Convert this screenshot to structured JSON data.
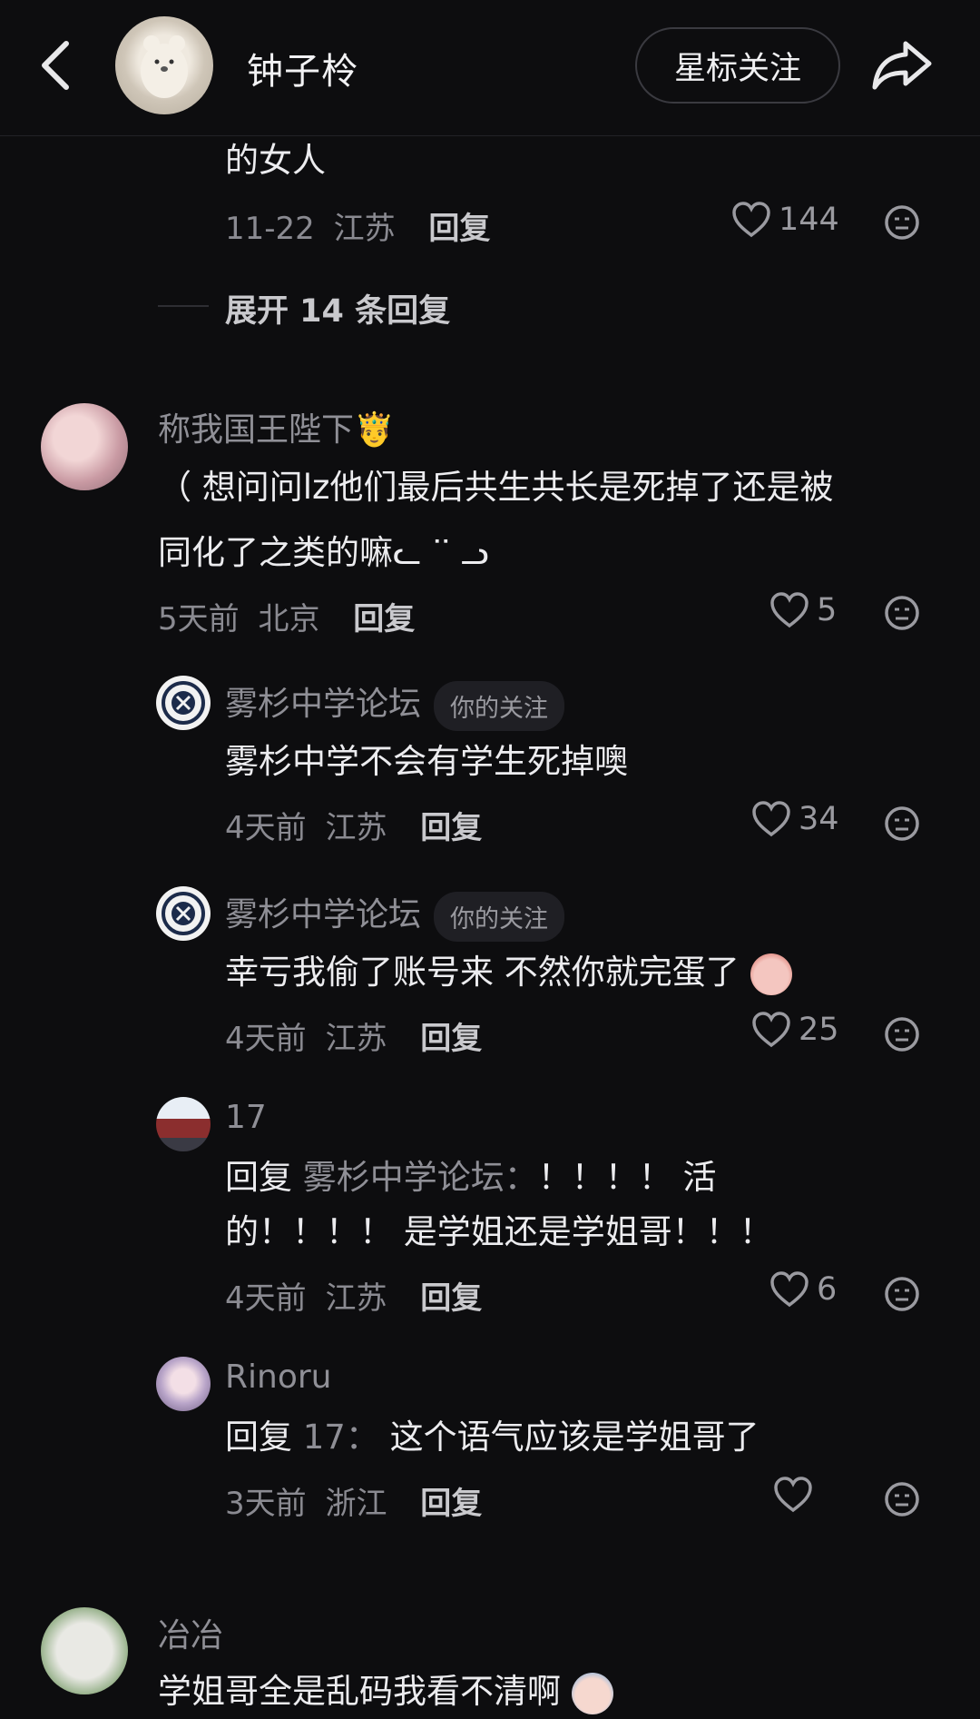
{
  "header": {
    "name": "钟子柃",
    "star_follow": "星标关注"
  },
  "top_comment": {
    "text_tail": "的女人",
    "time": "11-22",
    "location": "江苏",
    "reply": "回复",
    "likes": "144",
    "expand": "展开 14 条回复"
  },
  "comment_main": {
    "author": "称我国王陛下🤴",
    "text_line1": "（ 想问问lz他们最后共生共长是死掉了还是被",
    "text_line2": "同化了之类的嘛ᓚ ᐝᐝ ᓗ",
    "time": "5天前",
    "location": "北京",
    "reply": "回复",
    "likes": "5"
  },
  "replies": [
    {
      "author": "雾杉中学论坛",
      "badge": "你的关注",
      "text": "雾杉中学不会有学生死掉噢",
      "time": "4天前",
      "location": "江苏",
      "reply": "回复",
      "likes": "34"
    },
    {
      "author": "雾杉中学论坛",
      "badge": "你的关注",
      "text": "幸亏我偷了账号来 不然你就完蛋了",
      "time": "4天前",
      "location": "江苏",
      "reply": "回复",
      "likes": "25"
    },
    {
      "author": "17",
      "reply_prefix": "回复",
      "reply_to": "雾杉中学论坛：",
      "text_line1": "！！！！ 活",
      "text_line2": "的！！！！ 是学姐还是学姐哥！！！",
      "time": "4天前",
      "location": "江苏",
      "reply": "回复",
      "likes": "6"
    },
    {
      "author": "Rinoru",
      "reply_prefix": "回复",
      "reply_to": "17：",
      "text": "这个语气应该是学姐哥了",
      "time": "3天前",
      "location": "浙江",
      "reply": "回复",
      "likes": ""
    }
  ],
  "comment_bottom": {
    "author": "冶冶",
    "text": "学姐哥全是乱码我看不清啊"
  },
  "colors": {
    "background": "#0d0d0f",
    "text_primary": "#ececef",
    "text_secondary": "#8f8f96"
  }
}
